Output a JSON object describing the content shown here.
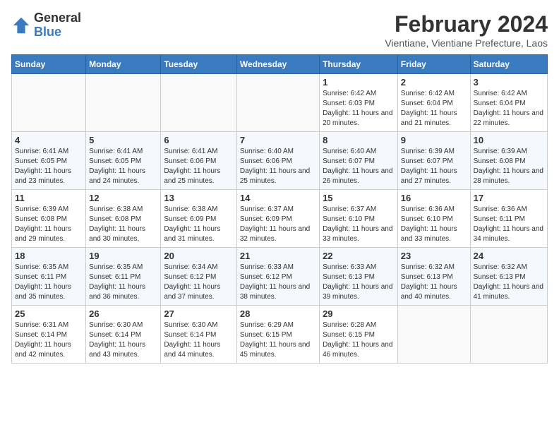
{
  "logo": {
    "general": "General",
    "blue": "Blue"
  },
  "title": "February 2024",
  "subtitle": "Vientiane, Vientiane Prefecture, Laos",
  "weekdays": [
    "Sunday",
    "Monday",
    "Tuesday",
    "Wednesday",
    "Thursday",
    "Friday",
    "Saturday"
  ],
  "weeks": [
    [
      {
        "day": "",
        "empty": true
      },
      {
        "day": "",
        "empty": true
      },
      {
        "day": "",
        "empty": true
      },
      {
        "day": "",
        "empty": true
      },
      {
        "day": "1",
        "sunrise": "6:42 AM",
        "sunset": "6:03 PM",
        "daylight": "11 hours and 20 minutes."
      },
      {
        "day": "2",
        "sunrise": "6:42 AM",
        "sunset": "6:04 PM",
        "daylight": "11 hours and 21 minutes."
      },
      {
        "day": "3",
        "sunrise": "6:42 AM",
        "sunset": "6:04 PM",
        "daylight": "11 hours and 22 minutes."
      }
    ],
    [
      {
        "day": "4",
        "sunrise": "6:41 AM",
        "sunset": "6:05 PM",
        "daylight": "11 hours and 23 minutes."
      },
      {
        "day": "5",
        "sunrise": "6:41 AM",
        "sunset": "6:05 PM",
        "daylight": "11 hours and 24 minutes."
      },
      {
        "day": "6",
        "sunrise": "6:41 AM",
        "sunset": "6:06 PM",
        "daylight": "11 hours and 25 minutes."
      },
      {
        "day": "7",
        "sunrise": "6:40 AM",
        "sunset": "6:06 PM",
        "daylight": "11 hours and 25 minutes."
      },
      {
        "day": "8",
        "sunrise": "6:40 AM",
        "sunset": "6:07 PM",
        "daylight": "11 hours and 26 minutes."
      },
      {
        "day": "9",
        "sunrise": "6:39 AM",
        "sunset": "6:07 PM",
        "daylight": "11 hours and 27 minutes."
      },
      {
        "day": "10",
        "sunrise": "6:39 AM",
        "sunset": "6:08 PM",
        "daylight": "11 hours and 28 minutes."
      }
    ],
    [
      {
        "day": "11",
        "sunrise": "6:39 AM",
        "sunset": "6:08 PM",
        "daylight": "11 hours and 29 minutes."
      },
      {
        "day": "12",
        "sunrise": "6:38 AM",
        "sunset": "6:08 PM",
        "daylight": "11 hours and 30 minutes."
      },
      {
        "day": "13",
        "sunrise": "6:38 AM",
        "sunset": "6:09 PM",
        "daylight": "11 hours and 31 minutes."
      },
      {
        "day": "14",
        "sunrise": "6:37 AM",
        "sunset": "6:09 PM",
        "daylight": "11 hours and 32 minutes."
      },
      {
        "day": "15",
        "sunrise": "6:37 AM",
        "sunset": "6:10 PM",
        "daylight": "11 hours and 33 minutes."
      },
      {
        "day": "16",
        "sunrise": "6:36 AM",
        "sunset": "6:10 PM",
        "daylight": "11 hours and 33 minutes."
      },
      {
        "day": "17",
        "sunrise": "6:36 AM",
        "sunset": "6:11 PM",
        "daylight": "11 hours and 34 minutes."
      }
    ],
    [
      {
        "day": "18",
        "sunrise": "6:35 AM",
        "sunset": "6:11 PM",
        "daylight": "11 hours and 35 minutes."
      },
      {
        "day": "19",
        "sunrise": "6:35 AM",
        "sunset": "6:11 PM",
        "daylight": "11 hours and 36 minutes."
      },
      {
        "day": "20",
        "sunrise": "6:34 AM",
        "sunset": "6:12 PM",
        "daylight": "11 hours and 37 minutes."
      },
      {
        "day": "21",
        "sunrise": "6:33 AM",
        "sunset": "6:12 PM",
        "daylight": "11 hours and 38 minutes."
      },
      {
        "day": "22",
        "sunrise": "6:33 AM",
        "sunset": "6:13 PM",
        "daylight": "11 hours and 39 minutes."
      },
      {
        "day": "23",
        "sunrise": "6:32 AM",
        "sunset": "6:13 PM",
        "daylight": "11 hours and 40 minutes."
      },
      {
        "day": "24",
        "sunrise": "6:32 AM",
        "sunset": "6:13 PM",
        "daylight": "11 hours and 41 minutes."
      }
    ],
    [
      {
        "day": "25",
        "sunrise": "6:31 AM",
        "sunset": "6:14 PM",
        "daylight": "11 hours and 42 minutes."
      },
      {
        "day": "26",
        "sunrise": "6:30 AM",
        "sunset": "6:14 PM",
        "daylight": "11 hours and 43 minutes."
      },
      {
        "day": "27",
        "sunrise": "6:30 AM",
        "sunset": "6:14 PM",
        "daylight": "11 hours and 44 minutes."
      },
      {
        "day": "28",
        "sunrise": "6:29 AM",
        "sunset": "6:15 PM",
        "daylight": "11 hours and 45 minutes."
      },
      {
        "day": "29",
        "sunrise": "6:28 AM",
        "sunset": "6:15 PM",
        "daylight": "11 hours and 46 minutes."
      },
      {
        "day": "",
        "empty": true
      },
      {
        "day": "",
        "empty": true
      }
    ]
  ]
}
